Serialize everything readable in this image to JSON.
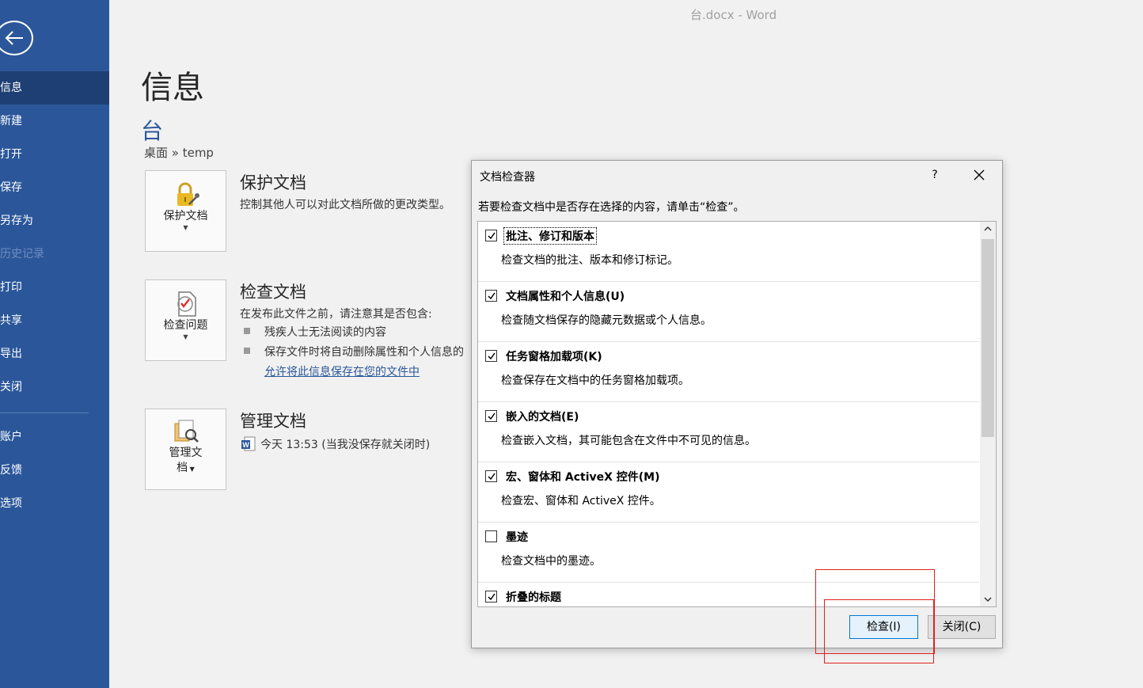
{
  "window": {
    "title": "台.docx  -  Word"
  },
  "nav": {
    "items": [
      {
        "label": "信息",
        "state": "active"
      },
      {
        "label": "新建",
        "state": "normal"
      },
      {
        "label": "打开",
        "state": "normal"
      },
      {
        "label": "保存",
        "state": "normal"
      },
      {
        "label": "另存为",
        "state": "normal"
      },
      {
        "label": "历史记录",
        "state": "disabled"
      },
      {
        "label": "打印",
        "state": "normal"
      },
      {
        "label": "共享",
        "state": "normal"
      },
      {
        "label": "导出",
        "state": "normal"
      },
      {
        "label": "关闭",
        "state": "normal"
      },
      {
        "label": "账户",
        "state": "normal"
      },
      {
        "label": "反馈",
        "state": "normal"
      },
      {
        "label": "选项",
        "state": "normal"
      }
    ]
  },
  "info": {
    "page_title": "信息",
    "doc_name": "台",
    "doc_path": "桌面 » temp",
    "protect": {
      "button_label": "保护文档",
      "title": "保护文档",
      "desc": "控制其他人可以对此文档所做的更改类型。"
    },
    "inspect": {
      "button_label": "检查问题",
      "title": "检查文档",
      "desc": "在发布此文件之前，请注意其是否包含:",
      "bullets": [
        "残疾人士无法阅读的内容",
        "保存文件时将自动删除属性和个人信息的"
      ],
      "link": "允许将此信息保存在您的文件中"
    },
    "manage": {
      "button_label_1": "管理文",
      "button_label_2": "档",
      "title": "管理文档",
      "version": "今天 13:53 (当我没保存就关闭时)"
    }
  },
  "dialog": {
    "title": "文档检查器",
    "help": "?",
    "instruction": "若要检查文档中是否存在选择的内容，请单击“检查”。",
    "items": [
      {
        "title": "批注、修订和版本",
        "desc": "检查文档的批注、版本和修订标记。",
        "checked": true
      },
      {
        "title": "文档属性和个人信息(U)",
        "desc": "检查随文档保存的隐藏元数据或个人信息。",
        "checked": true
      },
      {
        "title": "任务窗格加载项(K)",
        "desc": "检查保存在文档中的任务窗格加载项。",
        "checked": true
      },
      {
        "title": "嵌入的文档(E)",
        "desc": "检查嵌入文档，其可能包含在文件中不可见的信息。",
        "checked": true
      },
      {
        "title": "宏、窗体和 ActiveX 控件(M)",
        "desc": "检查宏、窗体和 ActiveX 控件。",
        "checked": true
      },
      {
        "title": "墨迹",
        "desc": "检查文档中的墨迹。",
        "checked": false
      },
      {
        "title": "折叠的标题",
        "desc": "",
        "checked": true
      }
    ],
    "inspect_button": "检查(I)",
    "close_button": "关闭(C)"
  },
  "colors": {
    "nav_bg": "#2b579a",
    "nav_active": "#1e3f73",
    "accent": "#2b579a",
    "highlight_box": "#e02020"
  }
}
